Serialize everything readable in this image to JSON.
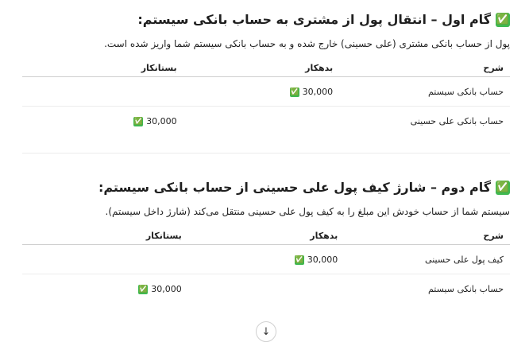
{
  "section1": {
    "check_icon": "✅",
    "title": "گام اول – انتقال پول از مشتری به حساب بانکی سیستم:",
    "description": "پول از حساب بانکی مشتری (علی حسینی) خارج شده و به حساب بانکی سیستم شما واریز شده است.",
    "headers": {
      "desc": "شرح",
      "debit": "بدهکار",
      "credit": "بستانکار"
    },
    "rows": [
      {
        "desc": "حساب بانکی سیستم",
        "debit": "30,000",
        "credit": ""
      },
      {
        "desc": "حساب بانکی علی حسینی",
        "debit": "",
        "credit": "30,000"
      }
    ]
  },
  "section2": {
    "check_icon": "✅",
    "title": "گام دوم – شارژ کیف پول علی حسینی از حساب بانکی سیستم:",
    "description": "سیستم شما از حساب خودش این مبلغ را به کیف پول علی حسینی منتقل می‌کند (شارژ داخل سیستم).",
    "headers": {
      "desc": "شرح",
      "debit": "بدهکار",
      "credit": "بستانکار"
    },
    "rows": [
      {
        "desc": "کیف پول علی حسینی",
        "debit": "30,000",
        "credit": ""
      },
      {
        "desc": "حساب بانکی سیستم",
        "debit": "",
        "credit": "30,000"
      }
    ]
  },
  "scroll_down_icon": "↓"
}
